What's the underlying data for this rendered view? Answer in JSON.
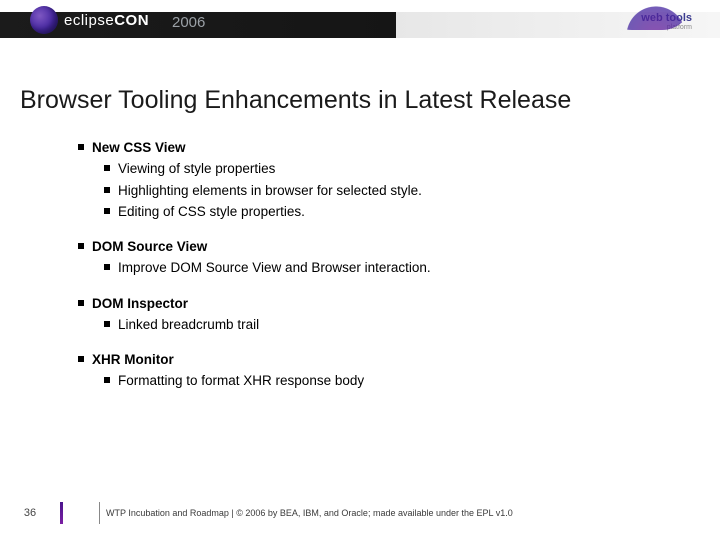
{
  "header": {
    "brand_left": "eclipse",
    "brand_right": "CON",
    "year": "2006",
    "webtools_label": "web tools",
    "webtools_sub": "platform"
  },
  "title": "Browser Tooling Enhancements in Latest Release",
  "sections": [
    {
      "heading": "New CSS View",
      "items": [
        "Viewing of style properties",
        "Highlighting elements in browser for selected style.",
        "Editing of CSS style properties."
      ]
    },
    {
      "heading": "DOM Source View",
      "items": [
        "Improve DOM Source View and Browser interaction."
      ]
    },
    {
      "heading": "DOM Inspector",
      "items": [
        "Linked breadcrumb trail"
      ]
    },
    {
      "heading": "XHR Monitor",
      "items": [
        "Formatting to format XHR response body"
      ]
    }
  ],
  "footer": {
    "page": "36",
    "text": "WTP Incubation and Roadmap  |  © 2006 by BEA, IBM, and Oracle; made available under the EPL v1.0"
  }
}
